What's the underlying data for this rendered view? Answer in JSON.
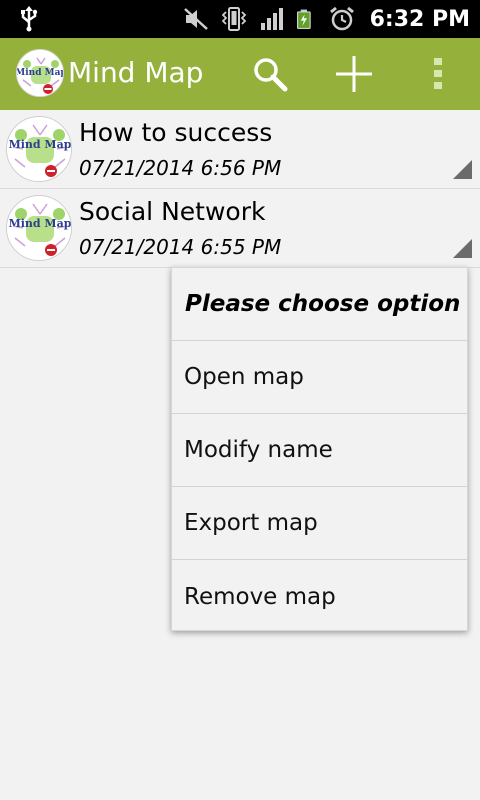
{
  "status_bar": {
    "time": "6:32 PM",
    "icons": [
      "usb-icon",
      "mute-icon",
      "vibrate-icon",
      "signal-icon",
      "battery-charging-icon",
      "alarm-icon"
    ]
  },
  "action_bar": {
    "title": "Mind Map",
    "color": "#95b13b",
    "buttons": [
      "search-icon",
      "add-icon",
      "overflow-menu-icon"
    ]
  },
  "maps": [
    {
      "name": "How to success",
      "date": "07/21/2014 6:56 PM"
    },
    {
      "name": "Social Network",
      "date": "07/21/2014 6:55 PM"
    }
  ],
  "thumbnail_text": "Mind Map",
  "popup": {
    "title": "Please choose option",
    "items": [
      "Open map",
      "Modify name",
      "Export map",
      "Remove map"
    ]
  }
}
